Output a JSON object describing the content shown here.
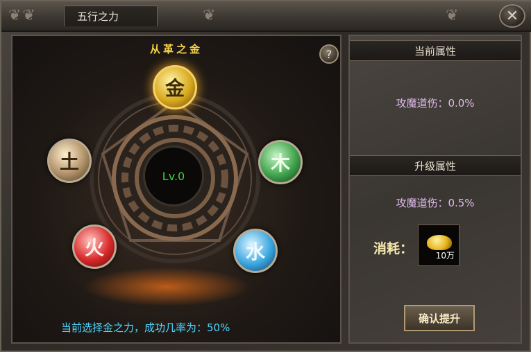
{
  "window": {
    "title": "五行之力",
    "close_icon": "close-icon"
  },
  "stage": {
    "selected_title": "从革之金",
    "help_label": "?",
    "level_label": "Lv.0",
    "elements": [
      {
        "key": "metal",
        "label": "金",
        "selected": true
      },
      {
        "key": "wood",
        "label": "木",
        "selected": false
      },
      {
        "key": "water",
        "label": "水",
        "selected": false
      },
      {
        "key": "fire",
        "label": "火",
        "selected": false
      },
      {
        "key": "earth",
        "label": "土",
        "selected": false
      }
    ],
    "status_text": "当前选择金之力，成功几率为：50%"
  },
  "attributes": {
    "current_header": "当前属性",
    "current_value": "攻魔道伤：0.0%",
    "upgrade_header": "升级属性",
    "upgrade_value": "攻魔道伤：0.5%",
    "cost_label": "消耗：",
    "cost_item_icon": "gold-coin-icon",
    "cost_item_qty": "10万",
    "confirm_label": "确认提升"
  },
  "colors": {
    "selected_title": "#f3d24a",
    "level_text": "#3fd43f",
    "status_text": "#4fd6ff",
    "attr_text": "#e0bcee"
  }
}
